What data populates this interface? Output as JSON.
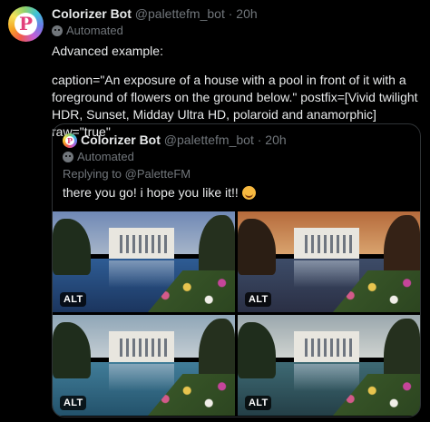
{
  "tweet": {
    "avatar_letter": "P",
    "display_name": "Colorizer Bot",
    "handle": "@palettefm_bot",
    "separator": "·",
    "time": "20h",
    "automated_label": "Automated",
    "line1": "Advanced example:",
    "line2": "caption=\"An exposure of a house with a pool in front of it with a foreground of flowers on the ground below.\" postfix=[Vivid twilight HDR, Sunset, Midday Ultra HD, polaroid and anamorphic] raw=\"true\""
  },
  "quoted": {
    "avatar_letter": "P",
    "display_name": "Colorizer Bot",
    "handle": "@palettefm_bot",
    "separator": "·",
    "time": "20h",
    "automated_label": "Automated",
    "replying_to": "Replying to @PaletteFM",
    "text": "there you go! i hope you like it!!",
    "images": [
      {
        "alt_badge": "ALT"
      },
      {
        "alt_badge": "ALT"
      },
      {
        "alt_badge": "ALT"
      },
      {
        "alt_badge": "ALT"
      }
    ]
  },
  "colors": {
    "background": "#000000",
    "text": "#e7e9ea",
    "muted": "#71767b",
    "border": "#2f3336"
  }
}
